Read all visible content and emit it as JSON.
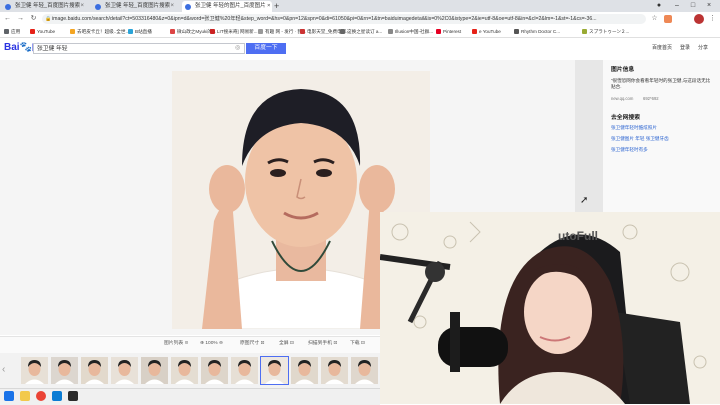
{
  "browser": {
    "tabs": [
      {
        "label": "张卫健 年轻_百度图片搜索",
        "active": false
      },
      {
        "label": "张卫健 年轻_百度图片搜索",
        "active": false
      },
      {
        "label": "张卫健 年轻的图片_百度图片 ×",
        "active": true
      }
    ],
    "new_tab": "+",
    "address": "image.baidu.com/search/detail?ct=503316480&z=0&ipn=d&word=张卫健%20年轻&step_word=&hs=0&pn=12&spn=0&di=61050&pi=0&rn=1&tn=baiduimagedetail&is=0%2C0&istype=2&ie=utf-8&oe=utf-8&in=&cl=2&lm=-1&st=-1&cs=-36..."
  },
  "bookmarks": [
    {
      "label": "应用",
      "color": "#5f6368"
    },
    {
      "label": "YouTube",
      "color": "#e62117"
    },
    {
      "label": "去吧皮卡丘！超级..全世...",
      "color": "#f4a522"
    },
    {
      "label": "B站直播",
      "color": "#2aa4d8"
    },
    {
      "label": "微山政之Myuki的...",
      "color": "#d44"
    },
    {
      "label": "LIT搜米奇] 网易新...",
      "color": "#c22"
    },
    {
      "label": "有趣 网 - 发行 · 我...",
      "color": "#999"
    },
    {
      "label": "电影天堂_免费电影...",
      "color": "#c33"
    },
    {
      "label": "这换之星读订 a...",
      "color": "#666"
    },
    {
      "label": "Illusion中国-社群...",
      "color": "#888"
    },
    {
      "label": "Pinterest",
      "color": "#e60023"
    },
    {
      "label": "e YouTube",
      "color": "#e62117"
    },
    {
      "label": "Rhythm Doctor C...",
      "color": "#555"
    },
    {
      "label": "スプラトゥーン２...",
      "color": "#9a3"
    }
  ],
  "baidu": {
    "logo": "Bai度图片",
    "search_value": "张卫健 年轻",
    "search_button": "百度一下",
    "top_links": [
      "百度首页",
      "登录",
      "分享"
    ]
  },
  "info_panel": {
    "title": "图片信息",
    "caption": "“很惶恐网你会看看年轻时的张卫健,与这段话无比贴合.",
    "source": "new.qq.com",
    "dimensions": "692*692",
    "search_title": "去全网搜索",
    "links": [
      "张卫健年轻时酷炫照片",
      "张卫健图片 年轻   张卫健牙齿",
      "张卫健年轻时有多"
    ]
  },
  "toolbar": {
    "items": [
      "图片列表 ⊙",
      "⊕ 100% ⊖",
      "原图尺寸 ⊡",
      "全屏 ⊡",
      "扫描到手机 ⊡",
      "下载 ⊡"
    ]
  },
  "thumbnails": 12,
  "selected_thumbnail": 8
}
